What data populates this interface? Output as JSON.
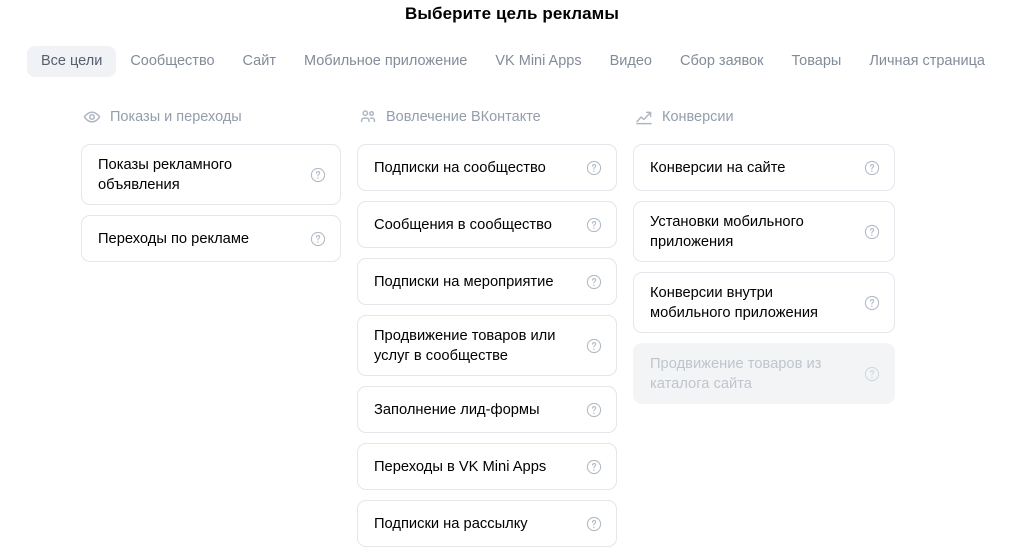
{
  "header": {
    "title": "Выберите цель рекламы"
  },
  "tabs": [
    {
      "label": "Все цели",
      "active": true
    },
    {
      "label": "Сообщество",
      "active": false
    },
    {
      "label": "Сайт",
      "active": false
    },
    {
      "label": "Мобильное приложение",
      "active": false
    },
    {
      "label": "VK Mini Apps",
      "active": false
    },
    {
      "label": "Видео",
      "active": false
    },
    {
      "label": "Сбор заявок",
      "active": false
    },
    {
      "label": "Товары",
      "active": false
    },
    {
      "label": "Личная страница",
      "active": false
    }
  ],
  "columns": [
    {
      "icon": "eye-icon",
      "title": "Показы и переходы",
      "cards": [
        {
          "label": "Показы рекламного объявления",
          "help_icon": "help-circle-icon",
          "disabled": false,
          "lines": 2
        },
        {
          "label": "Переходы по рекламе",
          "help_icon": "help-circle-icon",
          "disabled": false,
          "lines": 1
        }
      ]
    },
    {
      "icon": "users-icon",
      "title": "Вовлечение ВКонтакте",
      "cards": [
        {
          "label": "Подписки на сообщество",
          "help_icon": "help-circle-icon",
          "disabled": false,
          "lines": 1
        },
        {
          "label": "Сообщения в сообщество",
          "help_icon": "help-circle-icon",
          "disabled": false,
          "lines": 1
        },
        {
          "label": "Подписки на мероприятие",
          "help_icon": "help-circle-icon",
          "disabled": false,
          "lines": 1
        },
        {
          "label": "Продвижение товаров или услуг в сообществе",
          "help_icon": "help-circle-icon",
          "disabled": false,
          "lines": 2
        },
        {
          "label": "Заполнение лид-формы",
          "help_icon": "help-circle-icon",
          "disabled": false,
          "lines": 1
        },
        {
          "label": "Переходы в VK Mini Apps",
          "help_icon": "help-circle-icon",
          "disabled": false,
          "lines": 1
        },
        {
          "label": "Подписки на рассылку",
          "help_icon": "help-circle-icon",
          "disabled": false,
          "lines": 1
        }
      ]
    },
    {
      "icon": "trending-up-icon",
      "title": "Конверсии",
      "cards": [
        {
          "label": "Конверсии на сайте",
          "help_icon": "help-circle-icon",
          "disabled": false,
          "lines": 1
        },
        {
          "label": "Установки мобильного приложения",
          "help_icon": "help-circle-icon",
          "disabled": false,
          "lines": 2
        },
        {
          "label": "Конверсии внутри мобильного приложения",
          "help_icon": "help-circle-icon",
          "disabled": false,
          "lines": 2
        },
        {
          "label": "Продвижение товаров из каталога сайта",
          "help_icon": "help-circle-icon",
          "disabled": true,
          "lines": 2
        }
      ]
    }
  ],
  "colors": {
    "title_text": "#000000",
    "tab_text": "#818c99",
    "tab_active_bg": "#f0f2f5",
    "tab_active_text": "#55606e",
    "column_title": "#939dab",
    "card_border": "#e3e6ea",
    "card_text": "#000000",
    "card_disabled_bg": "#f3f4f6",
    "card_disabled_text": "#bfc5cd",
    "help_icon": "#b3bbc6"
  }
}
